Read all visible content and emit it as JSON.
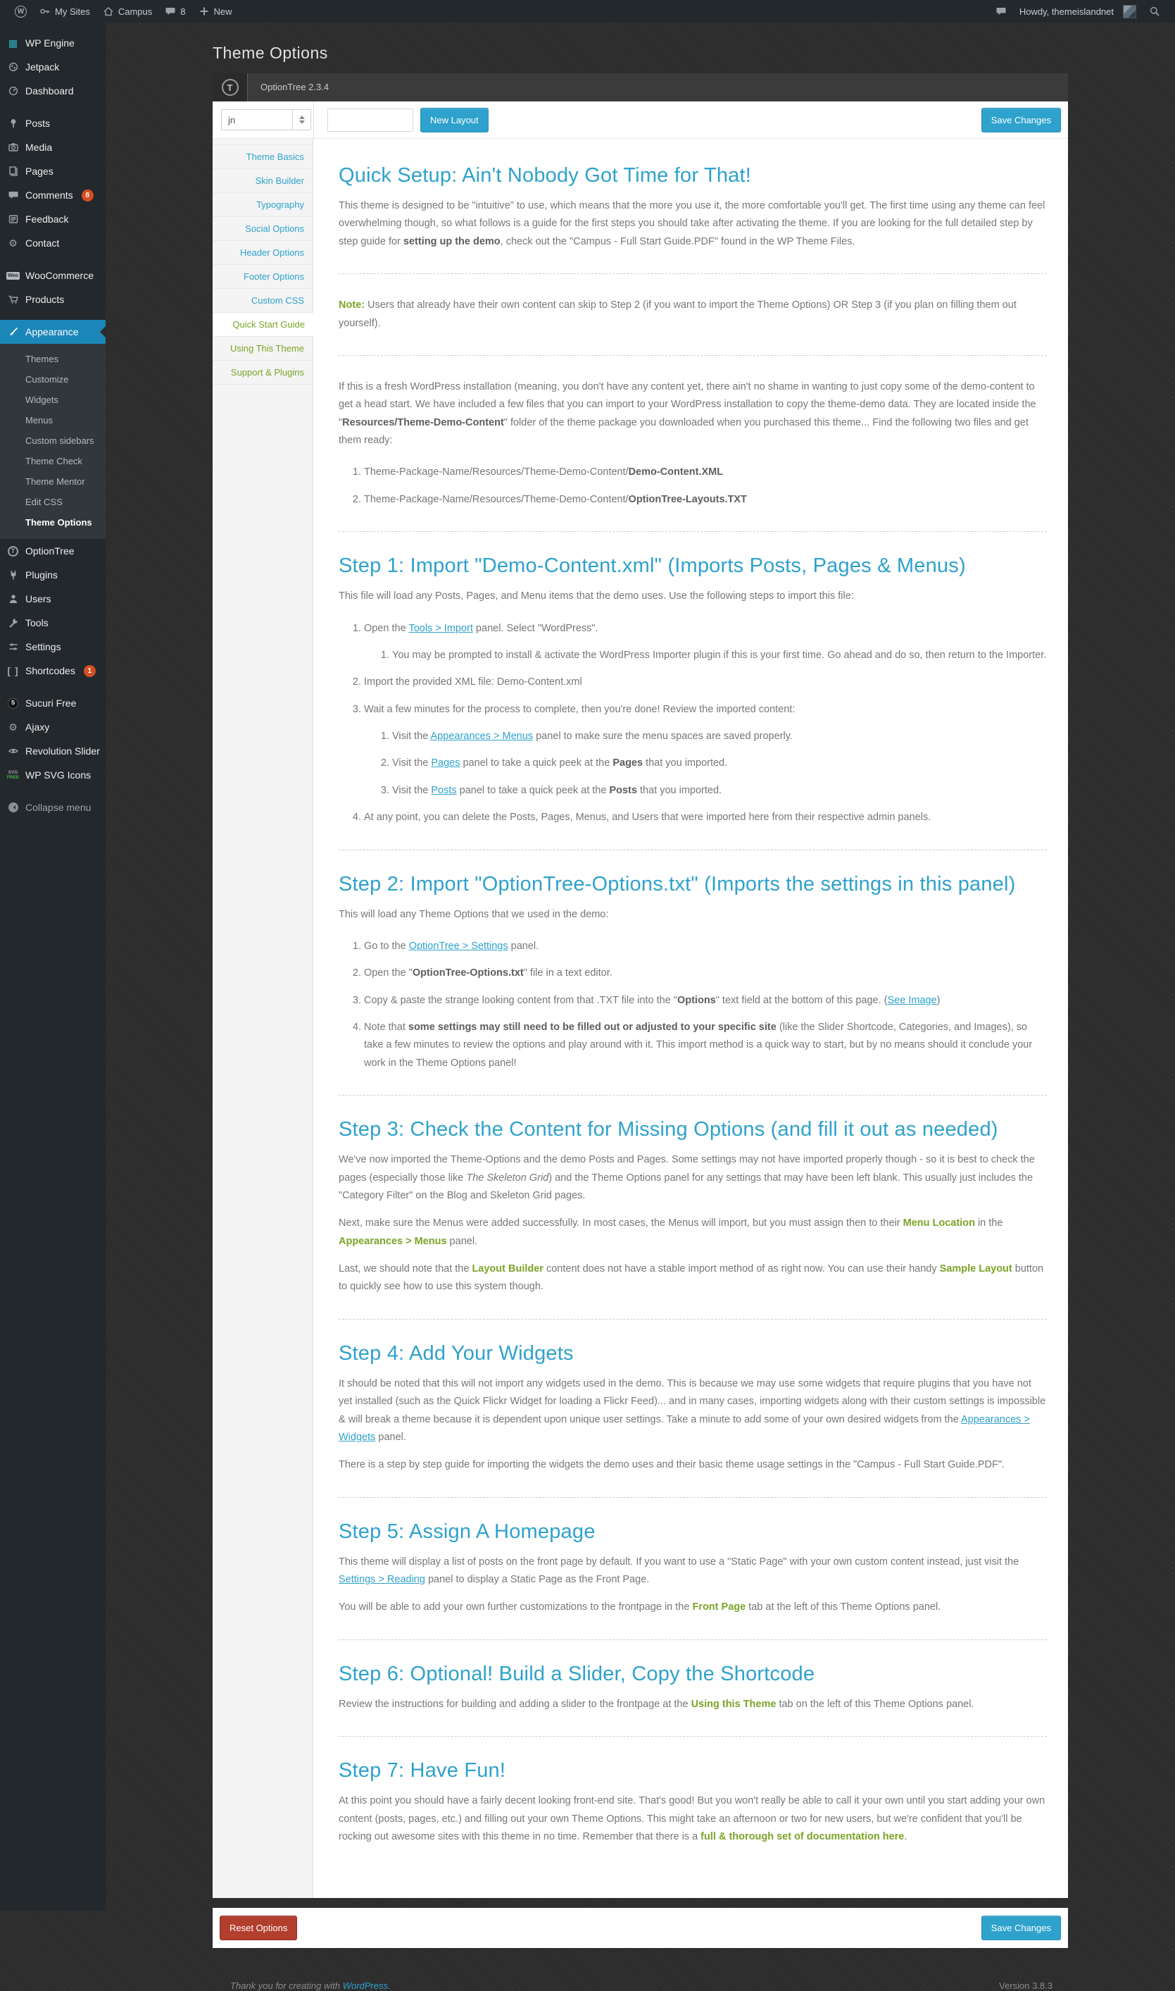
{
  "admin_bar": {
    "wp_logo": "W",
    "my_sites": "My Sites",
    "site": "Campus",
    "comment_count": "8",
    "new_item": "New",
    "howdy": "Howdy, themeislandnet"
  },
  "page": {
    "title": "Theme Options"
  },
  "sidebar": {
    "items": {
      "wp_engine": "WP Engine",
      "jetpack": "Jetpack",
      "dashboard": "Dashboard",
      "posts": "Posts",
      "media": "Media",
      "pages": "Pages",
      "comments": "Comments",
      "comments_badge": "8",
      "feedback": "Feedback",
      "contact": "Contact",
      "woocommerce": "WooCommerce",
      "products": "Products",
      "appearance": "Appearance",
      "optiontree": "OptionTree",
      "plugins": "Plugins",
      "users": "Users",
      "tools": "Tools",
      "settings": "Settings",
      "shortcodes": "Shortcodes",
      "shortcodes_badge": "1",
      "sucuri": "Sucuri Free",
      "ajaxy": "Ajaxy",
      "revslider": "Revolution Slider",
      "wpsvg": "WP SVG Icons",
      "collapse": "Collapse menu"
    },
    "appearance_submenu": [
      "Themes",
      "Customize",
      "Widgets",
      "Menus",
      "Custom sidebars",
      "Theme Check",
      "Theme Mentor",
      "Edit CSS",
      "Theme Options"
    ]
  },
  "panel": {
    "name": "OptionTree 2.3.4",
    "layout_value": "jn",
    "new_layout": "New Layout",
    "save_changes": "Save Changes",
    "reset_options": "Reset Options",
    "tabs": [
      "Theme Basics",
      "Skin Builder",
      "Typography",
      "Social Options",
      "Header Options",
      "Footer Options",
      "Custom CSS",
      "Quick Start Guide",
      "Using This Theme",
      "Support & Plugins"
    ],
    "active_tab": "Quick Start Guide"
  },
  "content": {
    "intro_heading": "Quick Setup: Ain't Nobody Got Time for That!",
    "intro": [
      {
        "text": "This theme is designed to be \"intuitive\" to use, which means that the more you use it, the more comfortable you'll get. The first time using any theme can feel overwhelming though, so what follows is a guide for the first steps you should take after activating the theme. If you are looking for the full detailed step by step guide for ",
        "style": "plain"
      },
      {
        "text": "setting up the demo",
        "style": "b"
      },
      {
        "text": ", check out the \"Campus - Full Start Guide.PDF\" found in the WP Theme Files.",
        "style": "plain"
      }
    ],
    "note": [
      {
        "text": "Note:",
        "style": "green"
      },
      {
        "text": " Users that already have their own content can skip to Step 2 (if you want to import the Theme Options) OR Step 3 (if you plan on filling them out yourself).",
        "style": "plain"
      }
    ],
    "fresh_p": [
      {
        "text": "If this is a fresh WordPress installation (meaning, you don't have any content yet, there ain't no shame in wanting to just copy some of the demo-content to get a head start. We have included a few files that you can import to your WordPress installation to copy the theme-demo data. They are located inside the \"",
        "style": "plain"
      },
      {
        "text": "Resources/Theme-Demo-Content",
        "style": "b"
      },
      {
        "text": "\" folder of the theme package you downloaded when you purchased this theme... Find the following two files and get them ready:",
        "style": "plain"
      }
    ],
    "fresh_li1": [
      {
        "text": "Theme-Package-Name/Resources/Theme-Demo-Content/",
        "style": "plain"
      },
      {
        "text": "Demo-Content.XML",
        "style": "b"
      }
    ],
    "fresh_li2": [
      {
        "text": "Theme-Package-Name/Resources/Theme-Demo-Content/",
        "style": "plain"
      },
      {
        "text": "OptionTree-Layouts.TXT",
        "style": "b"
      }
    ],
    "step1": {
      "heading": "Step 1: Import \"Demo-Content.xml\" (Imports Posts, Pages & Menus)",
      "p": [
        {
          "text": "This file will load any Posts, Pages, and Menu items that the demo uses. Use the following steps to import this file:",
          "style": "plain"
        }
      ],
      "li1": [
        {
          "text": "Open the ",
          "style": "plain"
        },
        {
          "text": "Tools > Import",
          "style": "link"
        },
        {
          "text": " panel. Select \"WordPress\".",
          "style": "plain"
        }
      ],
      "li1_1": [
        {
          "text": "You may be prompted to install & activate the WordPress Importer plugin if this is your first time. Go ahead and do so, then return to the Importer.",
          "style": "plain"
        }
      ],
      "li2": [
        {
          "text": "Import the provided XML file: Demo-Content.xml",
          "style": "plain"
        }
      ],
      "li3": [
        {
          "text": "Wait a few minutes for the process to complete, then you're done! Review the imported content:",
          "style": "plain"
        }
      ],
      "li3_1": [
        {
          "text": "Visit the ",
          "style": "plain"
        },
        {
          "text": "Appearances > Menus",
          "style": "link"
        },
        {
          "text": " panel to make sure the menu spaces are saved properly.",
          "style": "plain"
        }
      ],
      "li3_2": [
        {
          "text": "Visit the ",
          "style": "plain"
        },
        {
          "text": "Pages",
          "style": "link"
        },
        {
          "text": " panel to take a quick peek at the ",
          "style": "plain"
        },
        {
          "text": "Pages",
          "style": "b"
        },
        {
          "text": " that you imported.",
          "style": "plain"
        }
      ],
      "li3_3": [
        {
          "text": "Visit the ",
          "style": "plain"
        },
        {
          "text": "Posts",
          "style": "link"
        },
        {
          "text": " panel to take a quick peek at the ",
          "style": "plain"
        },
        {
          "text": "Posts",
          "style": "b"
        },
        {
          "text": " that you imported.",
          "style": "plain"
        }
      ],
      "li4": [
        {
          "text": "At any point, you can delete the Posts, Pages, Menus, and Users that were imported here from their respective admin panels.",
          "style": "plain"
        }
      ]
    },
    "step2": {
      "heading": "Step 2: Import \"OptionTree-Options.txt\" (Imports the settings in this panel)",
      "p": [
        {
          "text": "This will load any Theme Options that we used in the demo:",
          "style": "plain"
        }
      ],
      "li1": [
        {
          "text": "Go to the ",
          "style": "plain"
        },
        {
          "text": "OptionTree > Settings",
          "style": "link"
        },
        {
          "text": " panel.",
          "style": "plain"
        }
      ],
      "li2": [
        {
          "text": "Open the \"",
          "style": "plain"
        },
        {
          "text": "OptionTree-Options.txt",
          "style": "b"
        },
        {
          "text": "\" file in a text editor.",
          "style": "plain"
        }
      ],
      "li3": [
        {
          "text": "Copy & paste the strange looking content from that .TXT file into the \"",
          "style": "plain"
        },
        {
          "text": "Options",
          "style": "b"
        },
        {
          "text": "\" text field at the bottom of this page. (",
          "style": "plain"
        },
        {
          "text": "See Image",
          "style": "link"
        },
        {
          "text": ")",
          "style": "plain"
        }
      ],
      "li4": [
        {
          "text": "Note that ",
          "style": "plain"
        },
        {
          "text": "some settings may still need to be filled out or adjusted to your specific site",
          "style": "b"
        },
        {
          "text": " (like the Slider Shortcode, Categories, and Images), so take a few minutes to review the options and play around with it. This import method is a quick way to start, but by no means should it conclude your work in the Theme Options panel!",
          "style": "plain"
        }
      ]
    },
    "step3": {
      "heading": "Step 3: Check the Content for Missing Options (and fill it out as needed)",
      "p1": [
        {
          "text": "We've now imported the Theme-Options and the demo Posts and Pages. Some settings may not have imported properly though - so it is best to check the pages (especially those like ",
          "style": "plain"
        },
        {
          "text": "The Skeleton Grid",
          "style": "i"
        },
        {
          "text": ") and the Theme Options panel for any settings that may have been left blank. This usually just includes the \"Category Filter\" on the Blog and Skeleton Grid pages.",
          "style": "plain"
        }
      ],
      "p2": [
        {
          "text": "Next, make sure the Menus were added successfully. In most cases, the Menus will import, but you must assign then to their ",
          "style": "plain"
        },
        {
          "text": "Menu Location",
          "style": "green"
        },
        {
          "text": " in the ",
          "style": "plain"
        },
        {
          "text": "Appearances > Menus",
          "style": "green"
        },
        {
          "text": " panel.",
          "style": "plain"
        }
      ],
      "p3": [
        {
          "text": "Last, we should note that the ",
          "style": "plain"
        },
        {
          "text": "Layout Builder",
          "style": "green"
        },
        {
          "text": " content does not have a stable import method of as right now. You can use their handy ",
          "style": "plain"
        },
        {
          "text": "Sample Layout",
          "style": "green"
        },
        {
          "text": " button to quickly see how to use this system though.",
          "style": "plain"
        }
      ]
    },
    "step4": {
      "heading": "Step 4: Add Your Widgets",
      "p1": [
        {
          "text": "It should be noted that this will not import any widgets used in the demo. This is because we may use some widgets that require plugins that you have not yet installed (such as the Quick Flickr Widget for loading a Flickr Feed)... and in many cases, importing widgets along with their custom settings is impossible & will break a theme because it is dependent upon unique user settings. Take a minute to add some of your own desired widgets from the ",
          "style": "plain"
        },
        {
          "text": "Appearances > Widgets",
          "style": "link"
        },
        {
          "text": " panel.",
          "style": "plain"
        }
      ],
      "p2": [
        {
          "text": "There is a step by step guide for importing the widgets the demo uses and their basic theme usage settings in the \"Campus - Full Start Guide.PDF\".",
          "style": "plain"
        }
      ]
    },
    "step5": {
      "heading": "Step 5: Assign A Homepage",
      "p1": [
        {
          "text": "This theme will display a list of posts on the front page by default. If you want to use a \"Static Page\" with your own custom content instead, just visit the ",
          "style": "plain"
        },
        {
          "text": "Settings > Reading",
          "style": "link"
        },
        {
          "text": " panel to display a Static Page as the Front Page.",
          "style": "plain"
        }
      ],
      "p2": [
        {
          "text": "You will be able to add your own further customizations to the frontpage in the ",
          "style": "plain"
        },
        {
          "text": "Front Page",
          "style": "green"
        },
        {
          "text": " tab at the left of this Theme Options panel.",
          "style": "plain"
        }
      ]
    },
    "step6": {
      "heading": "Step 6: Optional! Build a Slider, Copy the Shortcode",
      "p": [
        {
          "text": "Review the instructions for building and adding a slider to the frontpage at the ",
          "style": "plain"
        },
        {
          "text": "Using this Theme",
          "style": "green"
        },
        {
          "text": " tab on the left of this Theme Options panel.",
          "style": "plain"
        }
      ]
    },
    "step7": {
      "heading": "Step 7: Have Fun!",
      "p": [
        {
          "text": "At this point you should have a fairly decent looking front-end site. That's good! But you won't really be able to call it your own until you start adding your own content (posts, pages, etc.) and filling out your own Theme Options. This might take an afternoon or two for new users, but we're confident that you'll be rocking out awesome sites with this theme in no time. Remember that there is a ",
          "style": "plain"
        },
        {
          "text": "full & thorough set of documentation here",
          "style": "green"
        },
        {
          "text": ".",
          "style": "plain"
        }
      ]
    }
  },
  "footer": {
    "thanks": "Thank you for creating with ",
    "wordpress_link": "WordPress.",
    "version": "Version 3.8.3"
  }
}
